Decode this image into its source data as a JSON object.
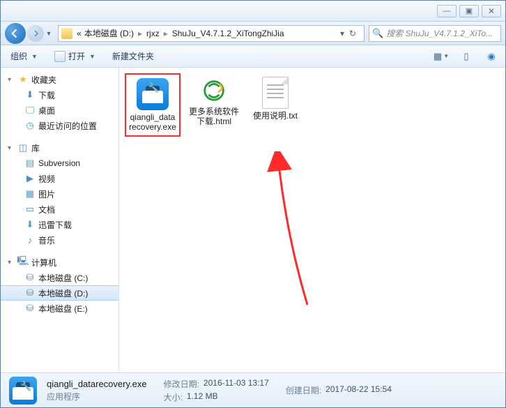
{
  "titlebar": {
    "min": "—",
    "max": "▣",
    "close": "✕"
  },
  "breadcrumb": {
    "prefix": "«",
    "items": [
      "本地磁盘 (D:)",
      "rjxz",
      "ShuJu_V4.7.1.2_XiTongZhiJia"
    ]
  },
  "search": {
    "placeholder": "搜索 ShuJu_V4.7.1.2_XiTo..."
  },
  "toolbar": {
    "organize": "组织",
    "open": "打开",
    "newfolder": "新建文件夹"
  },
  "sidebar": {
    "favorites": "收藏夹",
    "downloads": "下载",
    "desktop": "桌面",
    "recent": "最近访问的位置",
    "libraries": "库",
    "subversion": "Subversion",
    "videos": "视频",
    "pictures": "图片",
    "documents": "文档",
    "xunlei": "迅雷下载",
    "music": "音乐",
    "computer": "计算机",
    "drive_c": "本地磁盘 (C:)",
    "drive_d": "本地磁盘 (D:)",
    "drive_e": "本地磁盘 (E:)"
  },
  "files": [
    {
      "name": "qiangli_datarecovery.exe",
      "type": "exe",
      "highlighted": true
    },
    {
      "name": "更多系统软件下载.html",
      "type": "html",
      "highlighted": false
    },
    {
      "name": "使用说明.txt",
      "type": "txt",
      "highlighted": false
    }
  ],
  "status": {
    "filename": "qiangli_datarecovery.exe",
    "filetype": "应用程序",
    "modified_label": "修改日期:",
    "modified": "2016-11-03 13:17",
    "size_label": "大小:",
    "size": "1.12 MB",
    "created_label": "创建日期:",
    "created": "2017-08-22 15:54"
  }
}
